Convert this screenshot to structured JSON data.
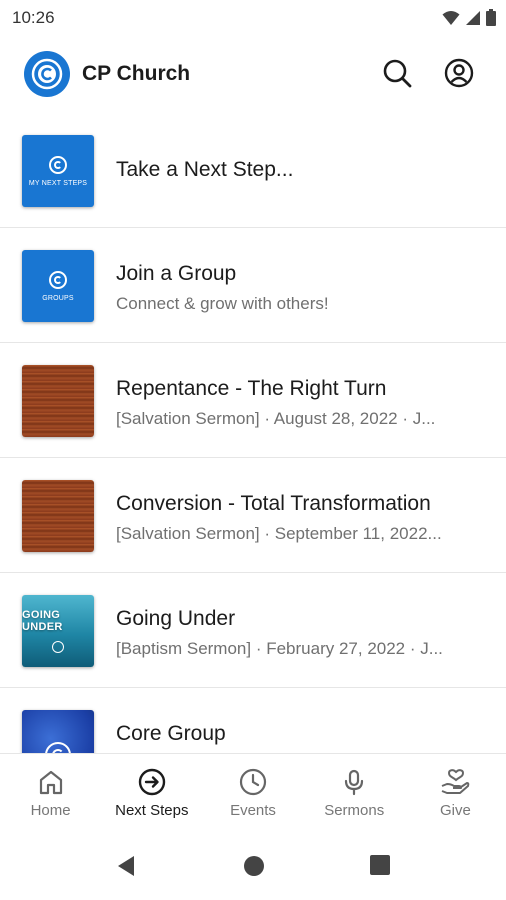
{
  "status_bar": {
    "time": "10:26",
    "icons": [
      "wifi-icon",
      "signal-icon",
      "battery-icon"
    ]
  },
  "header": {
    "title": "CP Church",
    "actions": [
      "search-icon",
      "account-icon"
    ]
  },
  "feed": [
    {
      "title": "Take a Next Step...",
      "subtitle": "",
      "thumb_caption": "MY NEXT STEPS"
    },
    {
      "title": "Join a Group",
      "subtitle": "Connect & grow with others!",
      "thumb_caption": "GROUPS"
    },
    {
      "title": "Repentance - The Right Turn",
      "subtitle": "[Salvation Sermon] · August 28, 2022 · J..."
    },
    {
      "title": "Conversion - Total Transformation",
      "subtitle": "[Salvation Sermon] · September 11, 2022..."
    },
    {
      "title": "Going Under",
      "subtitle": "[Baptism Sermon] · February 27, 2022 · J...",
      "thumb_caption": "GOING UNDER"
    },
    {
      "title": "Core Group",
      "subtitle": ""
    }
  ],
  "bottom_nav": [
    {
      "label": "Home",
      "icon": "home-icon",
      "active": false
    },
    {
      "label": "Next Steps",
      "icon": "arrow-circle-icon",
      "active": true
    },
    {
      "label": "Events",
      "icon": "clock-icon",
      "active": false
    },
    {
      "label": "Sermons",
      "icon": "microphone-icon",
      "active": false
    },
    {
      "label": "Give",
      "icon": "give-heart-icon",
      "active": false
    }
  ],
  "colors": {
    "brand": "#1976d2",
    "text": "#1c1c1c",
    "subtle": "#707070",
    "divider": "#e6e6e6"
  }
}
